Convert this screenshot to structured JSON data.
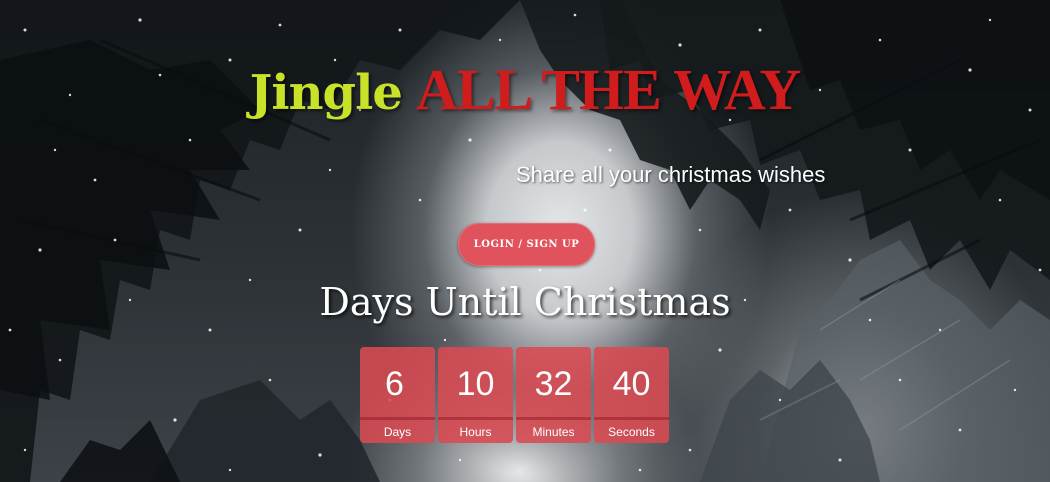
{
  "hero": {
    "title_part1": "Jingle",
    "title_part2": "ALL THE WAY",
    "tagline": "Share all your christmas wishes",
    "login_label": "LOGIN / SIGN UP"
  },
  "countdown": {
    "heading": "Days Until Christmas",
    "units": [
      {
        "value": "6",
        "label": "Days"
      },
      {
        "value": "10",
        "label": "Hours"
      },
      {
        "value": "32",
        "label": "Minutes"
      },
      {
        "value": "40",
        "label": "Seconds"
      }
    ]
  },
  "colors": {
    "jingle": "#c8e22a",
    "title_red": "#d01c1c",
    "button": "#e0535c",
    "countdown_box": "#da4a52"
  },
  "icons": {
    "background": "snowy-forest-canopy"
  }
}
